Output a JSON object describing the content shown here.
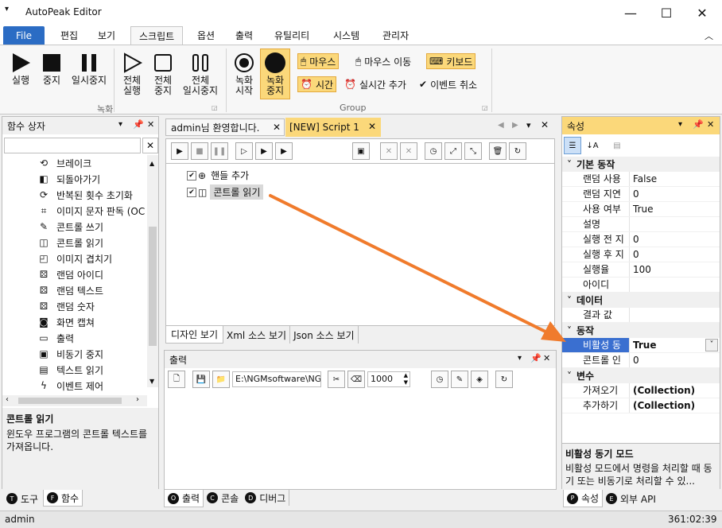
{
  "window": {
    "title": "AutoPeak Editor",
    "min": "—",
    "max": "☐",
    "close": "✕",
    "quick_access": "▾"
  },
  "ribbon_tabs": [
    {
      "label": "File"
    },
    {
      "label": "편집"
    },
    {
      "label": "보기"
    },
    {
      "label": "스크립트"
    },
    {
      "label": "옵션"
    },
    {
      "label": "출력"
    },
    {
      "label": "유틸리티"
    },
    {
      "label": "시스템"
    },
    {
      "label": "관리자"
    }
  ],
  "ribbon": {
    "run": "실행",
    "stop": "중지",
    "pause": "일시중지",
    "run_all_1": "전체",
    "run_all_2": "실행",
    "stop_all_1": "전체",
    "stop_all_2": "중지",
    "pause_all_1": "전체",
    "pause_all_2": "일시중지",
    "rec_start_1": "녹화",
    "rec_start_2": "시작",
    "rec_stop_1": "녹화",
    "rec_stop_2": "중지",
    "group_record": "녹화",
    "mouse": "마우스",
    "mouse_move": "마우스 이동",
    "keyboard": "키보드",
    "time": "시간",
    "realtime_add": "실시간 추가",
    "event_cancel": "이벤트 취소",
    "group_group": "Group"
  },
  "function_box": {
    "title": "함수 상자",
    "search_placeholder": "",
    "items": [
      {
        "label": "브레이크",
        "icon": "break-icon"
      },
      {
        "label": "되돌아가기",
        "icon": "back-icon"
      },
      {
        "label": "반복된 횟수 초기화",
        "icon": "reset-icon"
      },
      {
        "label": "이미지 문자 판독 (OC",
        "icon": "ocr-icon"
      },
      {
        "label": "콘트롤 쓰기",
        "icon": "pen-icon"
      },
      {
        "label": "콘트롤 읽기",
        "icon": "book-icon"
      },
      {
        "label": "이미지 겹치기",
        "icon": "overlay-icon"
      },
      {
        "label": "랜덤 아이디",
        "icon": "dice-icon"
      },
      {
        "label": "랜덤 텍스트",
        "icon": "dice-icon"
      },
      {
        "label": "랜덤 숫자",
        "icon": "dice-icon"
      },
      {
        "label": "화면 캡쳐",
        "icon": "camera-icon"
      },
      {
        "label": "출력",
        "icon": "print-icon"
      },
      {
        "label": "비동기 중지",
        "icon": "console-icon"
      },
      {
        "label": "텍스트 읽기",
        "icon": "text-icon"
      },
      {
        "label": "이벤트 제어",
        "icon": "bolt-icon"
      }
    ],
    "desc_title": "콘트롤 읽기",
    "desc_text": "윈도우 프로그램의 콘트롤 텍스트를 가져옵니다.",
    "tab_tools": "도구",
    "tab_tools_key": "T",
    "tab_funcs": "함수",
    "tab_funcs_key": "F"
  },
  "editor": {
    "tabs": [
      {
        "label": "admin님 환영합니다."
      },
      {
        "label": "[NEW] Script 1"
      }
    ],
    "nodes": [
      {
        "label": "핸들 추가"
      },
      {
        "label": "콘트롤 읽기"
      }
    ],
    "bottom_tabs": [
      {
        "label": "디자인 보기"
      },
      {
        "label": "Xml 소스 보기"
      },
      {
        "label": "Json 소스 보기"
      }
    ]
  },
  "output": {
    "title": "출력",
    "path": "E:\\NGMsoftware\\NG",
    "count": "1000",
    "tabs": [
      {
        "label": "출력",
        "key": "O"
      },
      {
        "label": "콘솔",
        "key": "C"
      },
      {
        "label": "디버그",
        "key": "D"
      }
    ]
  },
  "properties": {
    "title": "속성",
    "categories": [
      {
        "name": "기본 동작",
        "rows": [
          {
            "k": "랜덤 사용",
            "v": "False"
          },
          {
            "k": "랜덤 지연",
            "v": "0"
          },
          {
            "k": "사용 여부",
            "v": "True"
          },
          {
            "k": "설명",
            "v": ""
          },
          {
            "k": "실행 전 지",
            "v": "0"
          },
          {
            "k": "실행 후 지",
            "v": "0"
          },
          {
            "k": "실행율",
            "v": "100"
          },
          {
            "k": "아이디",
            "v": ""
          }
        ]
      },
      {
        "name": "데이터",
        "rows": [
          {
            "k": "결과 값",
            "v": ""
          }
        ]
      },
      {
        "name": "동작",
        "rows": [
          {
            "k": "비활성 동",
            "v": "True"
          },
          {
            "k": "콘트롤 인",
            "v": "0"
          }
        ]
      },
      {
        "name": "변수",
        "rows": [
          {
            "k": "가져오기",
            "v": "(Collection)"
          },
          {
            "k": "추가하기",
            "v": "(Collection)"
          }
        ]
      }
    ],
    "desc_title": "비활성 동기 모드",
    "desc_text": "비활성 모드에서 명령을 처리할 때 동기 또는 비동기로 처리할 수 있...",
    "tab_props": "속성",
    "tab_props_key": "P",
    "tab_api": "외부 API",
    "tab_api_key": "E"
  },
  "status": {
    "user": "admin",
    "time": "361:02:39"
  },
  "colors": {
    "accent": "#2b6cc4",
    "highlight": "#fbd87a",
    "arrow": "#f07b2c",
    "selection": "#3a6fd0"
  }
}
